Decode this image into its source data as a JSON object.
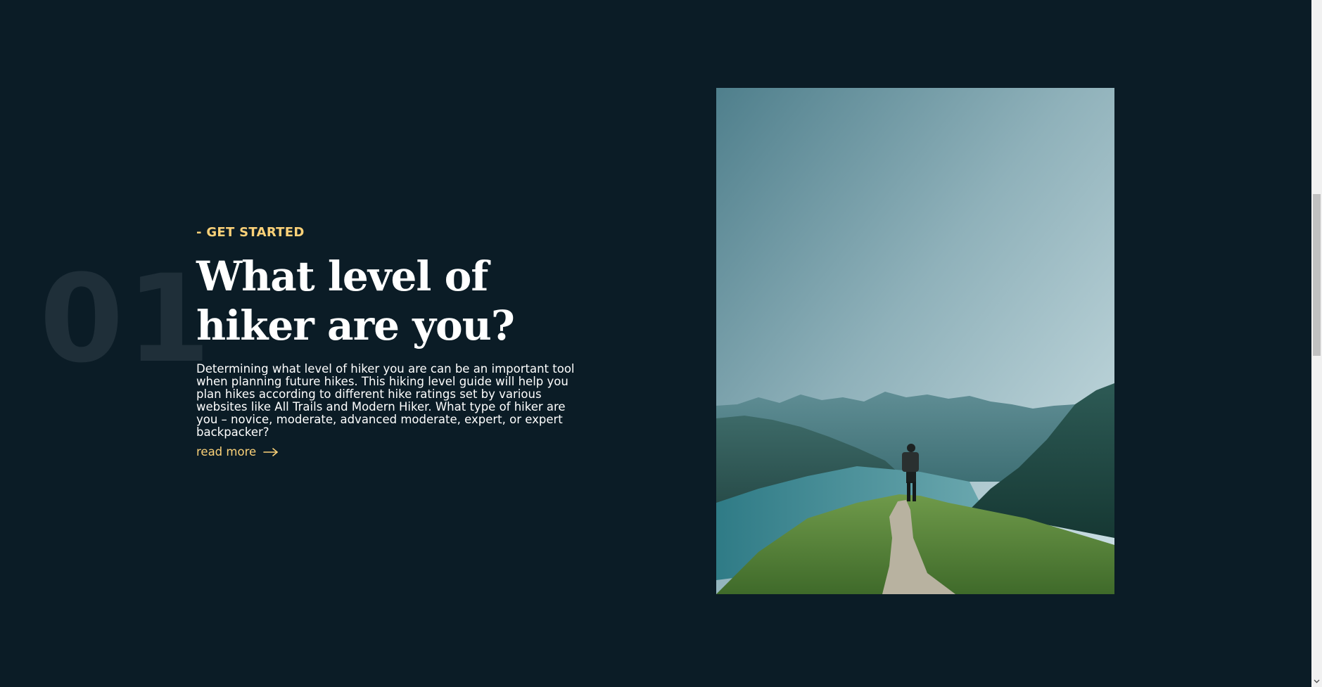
{
  "section": {
    "number": "01",
    "eyebrow": "- GET STARTED",
    "headline": "What level of hiker are you?",
    "description": "Determining what level of hiker you are can be an important tool when planning future hikes. This hiking level guide will help you plan hikes according to different hike ratings set by various websites like All Trails and Modern Hiker. What type of hiker are you – novice, moderate, advanced moderate, expert, or expert backpacker?",
    "read_more": "read more",
    "read_more_icon": "arrow-right-icon"
  },
  "photo": {
    "subject": "hiker-on-mountain-ridge-trail"
  },
  "colors": {
    "background": "#0b1c26",
    "accent": "#fbd178",
    "number": "#1f2f39",
    "text": "#ffffff"
  }
}
